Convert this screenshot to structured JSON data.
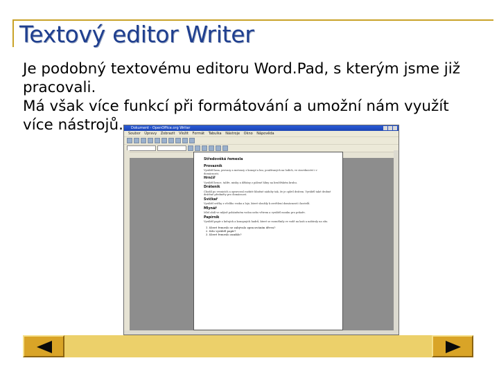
{
  "slide": {
    "title": "Textový editor Writer",
    "paragraph1": "Je podobný textovému editoru Word.Pad, s kterým jsme již pracovali.",
    "paragraph2": "Má však více funkcí při formátování a umožní nám využít více nástrojů."
  },
  "screenshot": {
    "window_title": "Dokument - OpenOffice.org Writer",
    "menu": "Soubor Úpravy Zobrazit Vložit Formát Tabulka Nástroje Okno Nápověda",
    "document": {
      "title": "Středověká řemesla",
      "sections": [
        {
          "heading": "Provazník",
          "text": "Vyráběl lana, provazy a motouzy z konopí a lnu, používaných na lodích, ve stavebnictví i v domácnosti."
        },
        {
          "heading": "Hrnčíř",
          "text": "Vyráběl hrnce, talíře, misky a džbány z pálené hlíny na hrnčířském kruhu."
        },
        {
          "heading": "Dráteník",
          "text": "Chodil po vesnicích a opravoval rozbité hliněné nádoby tak, že je opletl drátem. Vyráběl také drobné drátěné předměty pro domácnost."
        },
        {
          "heading": "Svíčkař",
          "text": "Vyráběl svíčky z včelího vosku a loje, které sloužily k osvětlení domácností i kostelů."
        },
        {
          "heading": "Mlynář",
          "text": "Mlel obilí ve mlýně poháněném vodou nebo větrem a vyráběl mouku pro pekaře."
        },
        {
          "heading": "Papírník",
          "text": "Vyráběl papír z lněných a konopných hadrů, které se rozmělnily ve vodě na kaši a nabíraly na síto."
        }
      ],
      "list": [
        "Které řemeslo se zabývalo zpracováním dřeva?",
        "Kdo vyráběl papír?",
        "Které řemeslo zaniklo?"
      ]
    }
  },
  "navigation": {
    "prev_icon": "triangle-left-icon",
    "next_icon": "triangle-right-icon"
  },
  "colors": {
    "title": "#1f3f8f",
    "frame": "#c9a227",
    "nav_bar": "#ecd06a",
    "nav_button": "#d9a427"
  }
}
